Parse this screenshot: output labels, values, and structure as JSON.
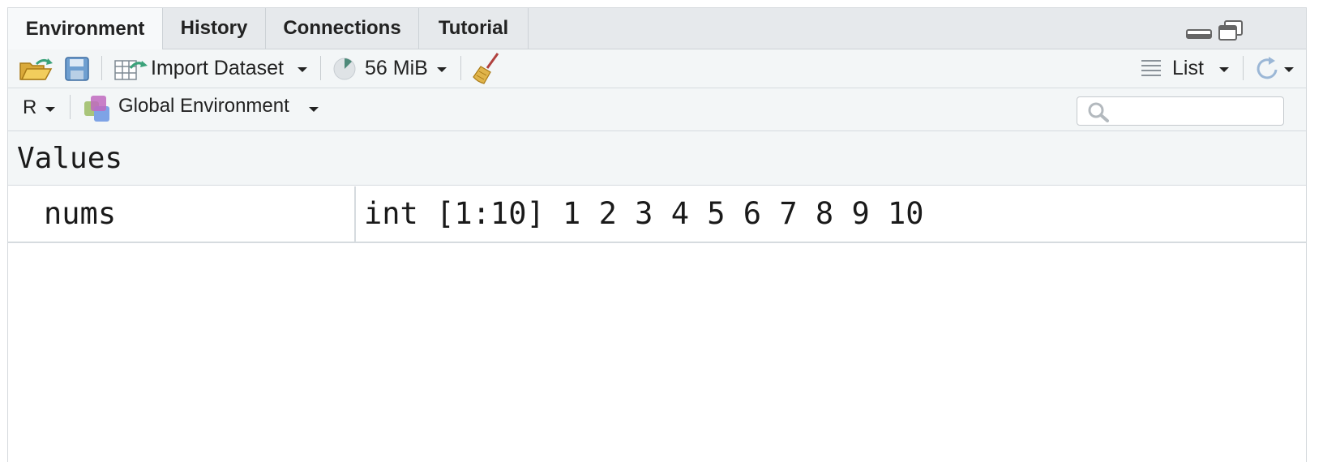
{
  "tabs": [
    {
      "label": "Environment",
      "active": true
    },
    {
      "label": "History",
      "active": false
    },
    {
      "label": "Connections",
      "active": false
    },
    {
      "label": "Tutorial",
      "active": false
    }
  ],
  "toolbar": {
    "import_dataset_label": "Import Dataset",
    "memory_label": "56 MiB",
    "view_mode_label": "List"
  },
  "env_bar": {
    "language_label": "R",
    "environment_label": "Global Environment",
    "search_placeholder": ""
  },
  "section": {
    "title": "Values"
  },
  "rows": [
    {
      "name": "nums",
      "value": "int [1:10] 1 2 3 4 5 6 7 8 9 10"
    }
  ],
  "colors": {
    "tab_bar_bg": "#e6e9ec",
    "toolbar_bg": "#f3f6f7",
    "border": "#d6dbdf"
  }
}
